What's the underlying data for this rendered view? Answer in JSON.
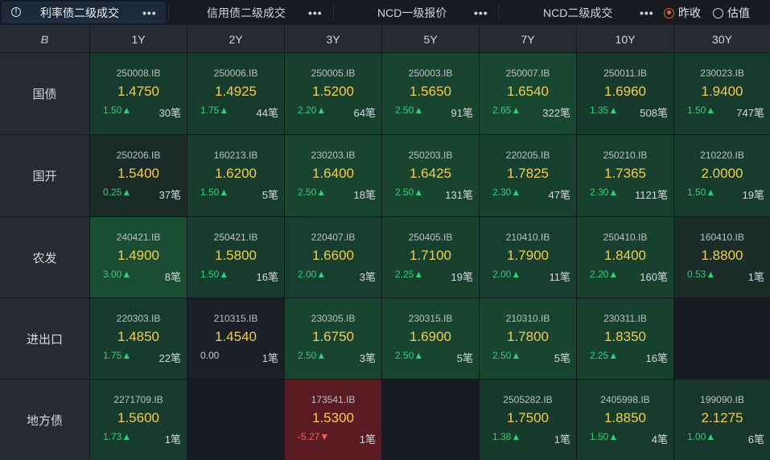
{
  "tabs": [
    {
      "label": "利率债二级成交",
      "active": true
    },
    {
      "label": "信用债二级成交",
      "active": false
    },
    {
      "label": "NCD一级报价",
      "active": false
    },
    {
      "label": "NCD二级成交",
      "active": false
    }
  ],
  "more_glyph": "•••",
  "radio_options": [
    {
      "label": "昨收",
      "selected": true
    },
    {
      "label": "估值",
      "selected": false
    }
  ],
  "corner_label": "B",
  "tenors": [
    "1Y",
    "2Y",
    "3Y",
    "5Y",
    "7Y",
    "10Y",
    "30Y"
  ],
  "rows": [
    {
      "name": "国债",
      "cells": [
        {
          "code": "250008.IB",
          "yield": "1.4750",
          "change": "1.50▲",
          "count": "30笔",
          "dir": "up",
          "bg": "#173c2e"
        },
        {
          "code": "250006.IB",
          "yield": "1.4925",
          "change": "1.75▲",
          "count": "44笔",
          "dir": "up",
          "bg": "#173c2e"
        },
        {
          "code": "250005.IB",
          "yield": "1.5200",
          "change": "2.20▲",
          "count": "64笔",
          "dir": "up",
          "bg": "#17402f"
        },
        {
          "code": "250003.IB",
          "yield": "1.5650",
          "change": "2.50▲",
          "count": "91笔",
          "dir": "up",
          "bg": "#184430"
        },
        {
          "code": "250007.IB",
          "yield": "1.6540",
          "change": "2.65▲",
          "count": "322笔",
          "dir": "up",
          "bg": "#184831"
        },
        {
          "code": "250011.IB",
          "yield": "1.6960",
          "change": "1.35▲",
          "count": "508笔",
          "dir": "up",
          "bg": "#173a2d"
        },
        {
          "code": "230023.IB",
          "yield": "1.9400",
          "change": "1.50▲",
          "count": "747笔",
          "dir": "up",
          "bg": "#173c2e"
        }
      ]
    },
    {
      "name": "国开",
      "cells": [
        {
          "code": "250206.IB",
          "yield": "1.5400",
          "change": "0.25▲",
          "count": "37笔",
          "dir": "up",
          "bg": "#1a2a27"
        },
        {
          "code": "160213.IB",
          "yield": "1.6200",
          "change": "1.50▲",
          "count": "5笔",
          "dir": "up",
          "bg": "#173c2e"
        },
        {
          "code": "230203.IB",
          "yield": "1.6400",
          "change": "2.50▲",
          "count": "18笔",
          "dir": "up",
          "bg": "#184430"
        },
        {
          "code": "250203.IB",
          "yield": "1.6425",
          "change": "2.50▲",
          "count": "131笔",
          "dir": "up",
          "bg": "#184430"
        },
        {
          "code": "220205.IB",
          "yield": "1.7825",
          "change": "2.30▲",
          "count": "47笔",
          "dir": "up",
          "bg": "#17402f"
        },
        {
          "code": "250210.IB",
          "yield": "1.7365",
          "change": "2.30▲",
          "count": "1121笔",
          "dir": "up",
          "bg": "#17402f"
        },
        {
          "code": "210220.IB",
          "yield": "2.0000",
          "change": "1.50▲",
          "count": "19笔",
          "dir": "up",
          "bg": "#173c2e"
        }
      ]
    },
    {
      "name": "农发",
      "cells": [
        {
          "code": "240421.IB",
          "yield": "1.4900",
          "change": "3.00▲",
          "count": "8笔",
          "dir": "up",
          "bg": "#1a4d33"
        },
        {
          "code": "250421.IB",
          "yield": "1.5800",
          "change": "1.50▲",
          "count": "16笔",
          "dir": "up",
          "bg": "#173c2e"
        },
        {
          "code": "220407.IB",
          "yield": "1.6600",
          "change": "2.00▲",
          "count": "3笔",
          "dir": "up",
          "bg": "#173e2e"
        },
        {
          "code": "250405.IB",
          "yield": "1.7100",
          "change": "2.25▲",
          "count": "19笔",
          "dir": "up",
          "bg": "#17402f"
        },
        {
          "code": "210410.IB",
          "yield": "1.7900",
          "change": "2.00▲",
          "count": "11笔",
          "dir": "up",
          "bg": "#173e2e"
        },
        {
          "code": "250410.IB",
          "yield": "1.8400",
          "change": "2.20▲",
          "count": "160笔",
          "dir": "up",
          "bg": "#17402f"
        },
        {
          "code": "160410.IB",
          "yield": "1.8800",
          "change": "0.53▲",
          "count": "1笔",
          "dir": "up",
          "bg": "#1a2d28"
        }
      ]
    },
    {
      "name": "进出口",
      "cells": [
        {
          "code": "220303.IB",
          "yield": "1.4850",
          "change": "1.75▲",
          "count": "22笔",
          "dir": "up",
          "bg": "#173c2e"
        },
        {
          "code": "210315.IB",
          "yield": "1.4540",
          "change": "0.00",
          "count": "1笔",
          "dir": "flat",
          "bg": "#1b1f26"
        },
        {
          "code": "230305.IB",
          "yield": "1.6750",
          "change": "2.50▲",
          "count": "3笔",
          "dir": "up",
          "bg": "#184430"
        },
        {
          "code": "230315.IB",
          "yield": "1.6900",
          "change": "2.50▲",
          "count": "5笔",
          "dir": "up",
          "bg": "#184430"
        },
        {
          "code": "210310.IB",
          "yield": "1.7800",
          "change": "2.50▲",
          "count": "5笔",
          "dir": "up",
          "bg": "#184430"
        },
        {
          "code": "230311.IB",
          "yield": "1.8350",
          "change": "2.25▲",
          "count": "16笔",
          "dir": "up",
          "bg": "#17402f"
        },
        null
      ]
    },
    {
      "name": "地方债",
      "cells": [
        {
          "code": "2271709.IB",
          "yield": "1.5600",
          "change": "1.73▲",
          "count": "1笔",
          "dir": "up",
          "bg": "#173c2e"
        },
        null,
        {
          "code": "173541.IB",
          "yield": "1.5300",
          "change": "-5.27▼",
          "count": "1笔",
          "dir": "dn",
          "bg": "#5a1c22"
        },
        null,
        {
          "code": "2505282.IB",
          "yield": "1.7500",
          "change": "1.38▲",
          "count": "1笔",
          "dir": "up",
          "bg": "#173a2d"
        },
        {
          "code": "2405998.IB",
          "yield": "1.8850",
          "change": "1.50▲",
          "count": "4笔",
          "dir": "up",
          "bg": "#173c2e"
        },
        {
          "code": "199090.IB",
          "yield": "2.1275",
          "change": "1.00▲",
          "count": "6笔",
          "dir": "up",
          "bg": "#17372c"
        }
      ]
    }
  ],
  "colors": {
    "up": "#2ed07a",
    "down": "#ff5b5b",
    "yield": "#f3cd4f",
    "empty_cell": "#171b21",
    "header_bg": "#272b31"
  }
}
